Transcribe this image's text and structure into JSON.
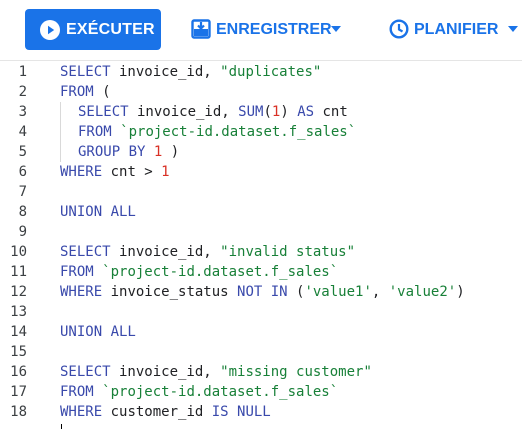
{
  "toolbar": {
    "run_label": "EXÉCUTER",
    "save_label": "ENREGISTRER",
    "schedule_label": "PLANIFIER",
    "icons": {
      "run": "play-circle-icon",
      "save": "save-icon",
      "schedule": "clock-icon",
      "dropdown": "caret-down-icon"
    }
  },
  "colors": {
    "accent": "#1a73e8",
    "keyword": "#3949ab",
    "string": "#188038",
    "number": "#d93025"
  },
  "editor": {
    "cursor_line": 19,
    "lines": [
      {
        "n": "1",
        "indent": 0,
        "tokens": [
          [
            "keyword",
            "SELECT"
          ],
          [
            "ident",
            " invoice_id, "
          ],
          [
            "string",
            "\"duplicates\""
          ]
        ]
      },
      {
        "n": "2",
        "indent": 0,
        "tokens": [
          [
            "keyword",
            "FROM"
          ],
          [
            "punct",
            " ("
          ]
        ]
      },
      {
        "n": "3",
        "indent": 1,
        "tokens": [
          [
            "keyword",
            "SELECT"
          ],
          [
            "ident",
            " invoice_id, "
          ],
          [
            "keyword",
            "SUM"
          ],
          [
            "punct",
            "("
          ],
          [
            "number",
            "1"
          ],
          [
            "punct",
            ") "
          ],
          [
            "keyword",
            "AS"
          ],
          [
            "ident",
            " cnt"
          ]
        ]
      },
      {
        "n": "4",
        "indent": 1,
        "tokens": [
          [
            "keyword",
            "FROM"
          ],
          [
            "ident",
            " "
          ],
          [
            "string",
            "`project-id.dataset.f_sales`"
          ]
        ]
      },
      {
        "n": "5",
        "indent": 1,
        "tokens": [
          [
            "keyword",
            "GROUP BY"
          ],
          [
            "ident",
            " "
          ],
          [
            "number",
            "1"
          ],
          [
            "punct",
            " )"
          ]
        ]
      },
      {
        "n": "6",
        "indent": 0,
        "tokens": [
          [
            "keyword",
            "WHERE"
          ],
          [
            "ident",
            " cnt > "
          ],
          [
            "number",
            "1"
          ]
        ]
      },
      {
        "n": "7",
        "indent": 0,
        "tokens": []
      },
      {
        "n": "8",
        "indent": 0,
        "tokens": [
          [
            "keyword",
            "UNION ALL"
          ]
        ]
      },
      {
        "n": "9",
        "indent": 0,
        "tokens": []
      },
      {
        "n": "10",
        "indent": 0,
        "tokens": [
          [
            "keyword",
            "SELECT"
          ],
          [
            "ident",
            " invoice_id, "
          ],
          [
            "string",
            "\"invalid status\""
          ]
        ]
      },
      {
        "n": "11",
        "indent": 0,
        "tokens": [
          [
            "keyword",
            "FROM"
          ],
          [
            "ident",
            " "
          ],
          [
            "string",
            "`project-id.dataset.f_sales`"
          ]
        ]
      },
      {
        "n": "12",
        "indent": 0,
        "tokens": [
          [
            "keyword",
            "WHERE"
          ],
          [
            "ident",
            " invoice_status "
          ],
          [
            "keyword",
            "NOT IN"
          ],
          [
            "punct",
            " ("
          ],
          [
            "string",
            "'value1'"
          ],
          [
            "punct",
            ", "
          ],
          [
            "string",
            "'value2'"
          ],
          [
            "punct",
            ")"
          ]
        ]
      },
      {
        "n": "13",
        "indent": 0,
        "tokens": []
      },
      {
        "n": "14",
        "indent": 0,
        "tokens": [
          [
            "keyword",
            "UNION ALL"
          ]
        ]
      },
      {
        "n": "15",
        "indent": 0,
        "tokens": []
      },
      {
        "n": "16",
        "indent": 0,
        "tokens": [
          [
            "keyword",
            "SELECT"
          ],
          [
            "ident",
            " invoice_id, "
          ],
          [
            "string",
            "\"missing customer\""
          ]
        ]
      },
      {
        "n": "17",
        "indent": 0,
        "tokens": [
          [
            "keyword",
            "FROM"
          ],
          [
            "ident",
            " "
          ],
          [
            "string",
            "`project-id.dataset.f_sales`"
          ]
        ]
      },
      {
        "n": "18",
        "indent": 0,
        "tokens": [
          [
            "keyword",
            "WHERE"
          ],
          [
            "ident",
            " customer_id "
          ],
          [
            "keyword",
            "IS NULL"
          ]
        ]
      },
      {
        "n": "",
        "indent": 0,
        "tokens": []
      }
    ]
  }
}
